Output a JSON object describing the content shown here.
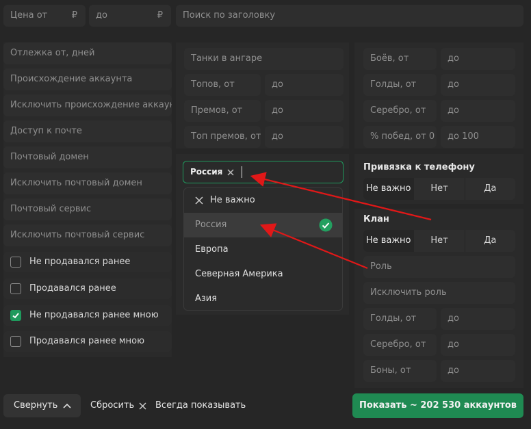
{
  "top": {
    "price_from": "Цена от",
    "price_to": "до",
    "currency": "₽",
    "search_placeholder": "Поиск по заголовку"
  },
  "left": {
    "fields": [
      "Отлежка от, дней",
      "Происхождение аккаунта",
      "Исключить происхождение аккаунт",
      "Доступ к почте",
      "Почтовый домен",
      "Исключить почтовый домен",
      "Почтовый сервис",
      "Исключить почтовый сервис"
    ],
    "checkboxes": [
      {
        "label": "Не продавался ранее",
        "checked": false
      },
      {
        "label": "Продавался ранее",
        "checked": false
      },
      {
        "label": "Не продавался ранее мною",
        "checked": true
      },
      {
        "label": "Продавался ранее мною",
        "checked": false
      }
    ]
  },
  "middle": {
    "tanks": "Танки в ангаре",
    "tops_from": "Топов, от",
    "prems_from": "Премов, от",
    "top_prems_from": "Топ премов, от",
    "to": "до"
  },
  "region": {
    "tag": "Россия",
    "options": [
      "Не важно",
      "Россия",
      "Европа",
      "Северная Америка",
      "Азия"
    ],
    "selected_index": 1
  },
  "right": {
    "battles_from": "Боёв, от",
    "gold_from": "Голды, от",
    "silver_from": "Серебро, от",
    "winrate_from": "% побед, от 0",
    "winrate_to": "до 100",
    "to": "до",
    "phone_title": "Привязка к телефону",
    "phone_options": [
      "Не важно",
      "Нет",
      "Да"
    ],
    "clan_title": "Клан",
    "clan_options": [
      "Не важно",
      "Нет",
      "Да"
    ],
    "role": "Роль",
    "exclude_role": "Исключить роль",
    "clan_gold_from": "Голды, от",
    "clan_silver_from": "Серебро, от",
    "bonds_from": "Боны, от"
  },
  "bottom": {
    "collapse": "Свернуть",
    "reset": "Сбросить",
    "always_show": "Всегда показывать",
    "show": "Показать ~ 202 530 аккаунтов"
  },
  "colors": {
    "accent": "#1f9a5d",
    "arrow": "#e01818"
  }
}
